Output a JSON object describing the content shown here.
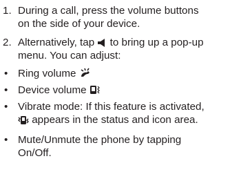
{
  "steps": [
    {
      "number": "1.",
      "line1": "During a call, press the volume buttons",
      "line2": "on the side of your device."
    },
    {
      "number": "2.",
      "line1_pre": "Alternatively, tap",
      "line1_post": "to bring up a pop-up",
      "line2": "menu. You can adjust:",
      "icon": "speaker-icon"
    }
  ],
  "bullets": [
    {
      "marker": "•",
      "text": "Ring volume",
      "icon": "ring-phone-icon"
    },
    {
      "marker": "•",
      "text": "Device volume",
      "icon": "device-vibrate-icon"
    },
    {
      "marker": "•",
      "line1": "Vibrate mode: If this feature is activated,",
      "line2": "appears in the status and icon area.",
      "icon": "vibrate-status-icon"
    },
    {
      "marker": "•",
      "line1": "Mute/Unmute the phone by tapping",
      "line2": "On/Off."
    }
  ],
  "colors": {
    "text": "#231f20"
  }
}
